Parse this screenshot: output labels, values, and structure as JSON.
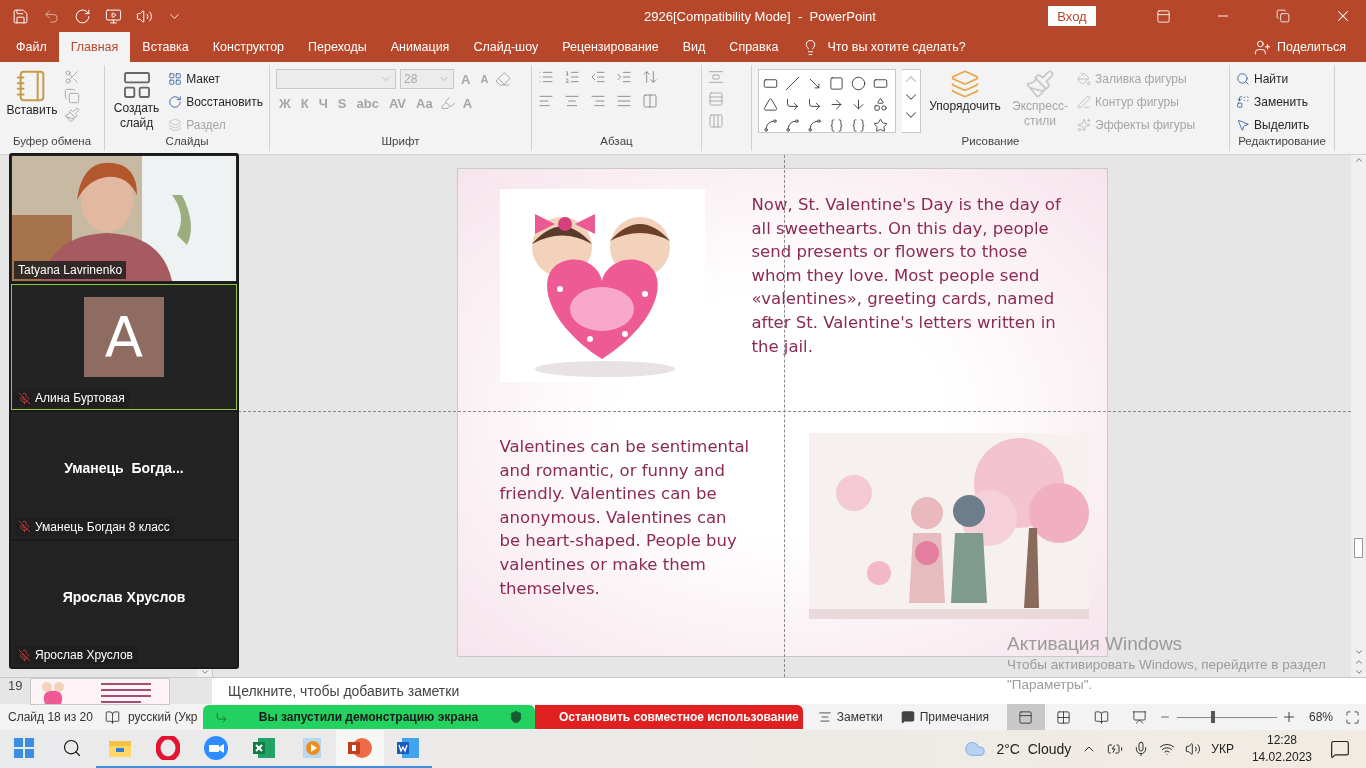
{
  "window": {
    "title": "2926[Compatibility Mode]  -  PowerPoint",
    "sign_in": "Вход"
  },
  "tabs": [
    {
      "label": "Файл",
      "selected": false
    },
    {
      "label": "Главная",
      "selected": true
    },
    {
      "label": "Вставка",
      "selected": false
    },
    {
      "label": "Конструктор",
      "selected": false
    },
    {
      "label": "Переходы",
      "selected": false
    },
    {
      "label": "Анимация",
      "selected": false
    },
    {
      "label": "Слайд-шоу",
      "selected": false
    },
    {
      "label": "Рецензирование",
      "selected": false
    },
    {
      "label": "Вид",
      "selected": false
    },
    {
      "label": "Справка",
      "selected": false
    }
  ],
  "tell_me": "Что вы хотите сделать?",
  "share": "Поделиться",
  "ribbon": {
    "clipboard": {
      "label": "Буфер обмена",
      "paste": "Вставить"
    },
    "slides": {
      "label": "Слайды",
      "new_slide": "Создать слайд",
      "items": [
        {
          "label": "Макет",
          "disabled": false
        },
        {
          "label": "Восстановить",
          "disabled": false
        },
        {
          "label": "Раздел",
          "disabled": true
        }
      ]
    },
    "font": {
      "label": "Шрифт",
      "size": "28",
      "disabled": true,
      "grow": "A",
      "shrink": "A",
      "text_color_button": "A",
      "buttons": [
        "Ж",
        "К",
        "Ч",
        "S",
        "abc",
        "AV",
        "Aa"
      ]
    },
    "paragraph": {
      "label": "Абзац"
    },
    "drawing": {
      "label": "Рисование",
      "arrange": "Упорядочить",
      "quick_styles": "Экспресс-стили",
      "quick_styles_disabled": true,
      "items": [
        {
          "label": "Заливка фигуры",
          "disabled": true
        },
        {
          "label": "Контур фигуры",
          "disabled": true
        },
        {
          "label": "Эффекты фигуры",
          "disabled": true
        }
      ]
    },
    "editing": {
      "label": "Редактирование",
      "items": [
        "Найти",
        "Заменить",
        "Выделить"
      ]
    }
  },
  "meeting": {
    "participants": [
      {
        "kind": "video",
        "name": "Tatyana Lavrinenko",
        "muted": false,
        "active": false
      },
      {
        "kind": "avatar",
        "initial": "A",
        "name": "Алина Буртовая",
        "muted": true,
        "active": true
      },
      {
        "kind": "name",
        "display": "Уманець  Богда...",
        "name": "Уманець Богдан 8 класс",
        "muted": true,
        "active": false
      },
      {
        "kind": "name",
        "display": "Ярослав Хруслов",
        "name": "Ярослав Хруслов",
        "muted": true,
        "active": false
      }
    ]
  },
  "slide": {
    "text_top": "Now, St. Valentine's Day is the day of all sweethearts. On this day, people send presents or flowers to those whom they love. Most people send «valentines», greeting cards, named after St. Valentine's letters written in the jail.",
    "text_bottom": "Valentines can be sentimental and romantic, or funny and friendly. Valentines can be anonymous. Valentines can be heart-shaped. People buy valentines or make them themselves."
  },
  "thumbnail": {
    "number": "19"
  },
  "notes": {
    "placeholder": "Щелкните, чтобы добавить заметки"
  },
  "activation": {
    "title": "Активация Windows",
    "text": "Чтобы активировать Windows, перейдите в раздел \"Параметры\"."
  },
  "status_bar": {
    "slide": "Слайд 18 из 20",
    "language": "русский (Укр",
    "notes": "Заметки",
    "comments": "Примечания",
    "views": [
      {
        "kind": "normal",
        "selected": true
      },
      {
        "kind": "sorter",
        "selected": false
      },
      {
        "kind": "reading",
        "selected": false
      },
      {
        "kind": "show",
        "selected": false
      }
    ],
    "zoom": {
      "level": 0.36,
      "reading": "68%"
    }
  },
  "share_bar": {
    "message": "Вы запустили демонстрацию экрана",
    "stop": "Остановить совместное использование"
  },
  "taskbar": {
    "apps": [
      {
        "kind": "explorer",
        "selected": false
      },
      {
        "kind": "opera",
        "selected": false
      },
      {
        "kind": "zoom",
        "selected": false
      },
      {
        "kind": "excel",
        "selected": false
      },
      {
        "kind": "player",
        "selected": false
      },
      {
        "kind": "powerpoint",
        "selected": true
      },
      {
        "kind": "word",
        "selected": false
      }
    ],
    "weather": "2°C  Cloudy",
    "language": "УКР",
    "time": "12:28",
    "date": "14.02.2023"
  }
}
